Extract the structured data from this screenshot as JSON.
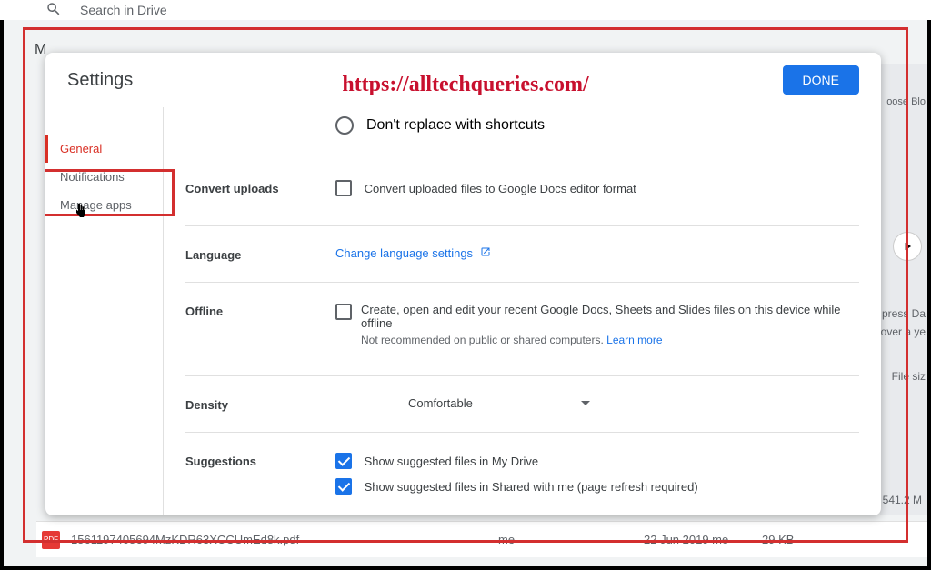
{
  "watermark": "https://alltechqueries.com/",
  "bg": {
    "search_placeholder": "Search in Drive",
    "m_label": "M",
    "right_text1": "press Da",
    "right_text2": "over a ye",
    "right_choose": "oose Blo",
    "filesize_header": "File siz",
    "size_5412": "541.2 M",
    "file": {
      "name": "1561197405694MzKDR63XCCUmEd8k.pdf",
      "owner": "me",
      "modified": "22 Jun 2019  me",
      "size": "29 KB"
    }
  },
  "dialog": {
    "title": "Settings",
    "done": "DONE",
    "sidebar": {
      "general": "General",
      "notifications": "Notifications",
      "manage_apps": "Manage apps"
    },
    "content": {
      "shortcut_radio": "Don't replace with shortcuts",
      "convert": {
        "label": "Convert uploads",
        "text": "Convert uploaded files to Google Docs editor format"
      },
      "language": {
        "label": "Language",
        "link": "Change language settings"
      },
      "offline": {
        "label": "Offline",
        "text": "Create, open and edit your recent Google Docs, Sheets and Slides files on this device while offline",
        "subtext": "Not recommended on public or shared computers. ",
        "learn_more": "Learn more"
      },
      "density": {
        "label": "Density",
        "value": "Comfortable"
      },
      "suggestions": {
        "label": "Suggestions",
        "opt1": "Show suggested files in My Drive",
        "opt2": "Show suggested files in Shared with me (page refresh required)"
      }
    }
  }
}
